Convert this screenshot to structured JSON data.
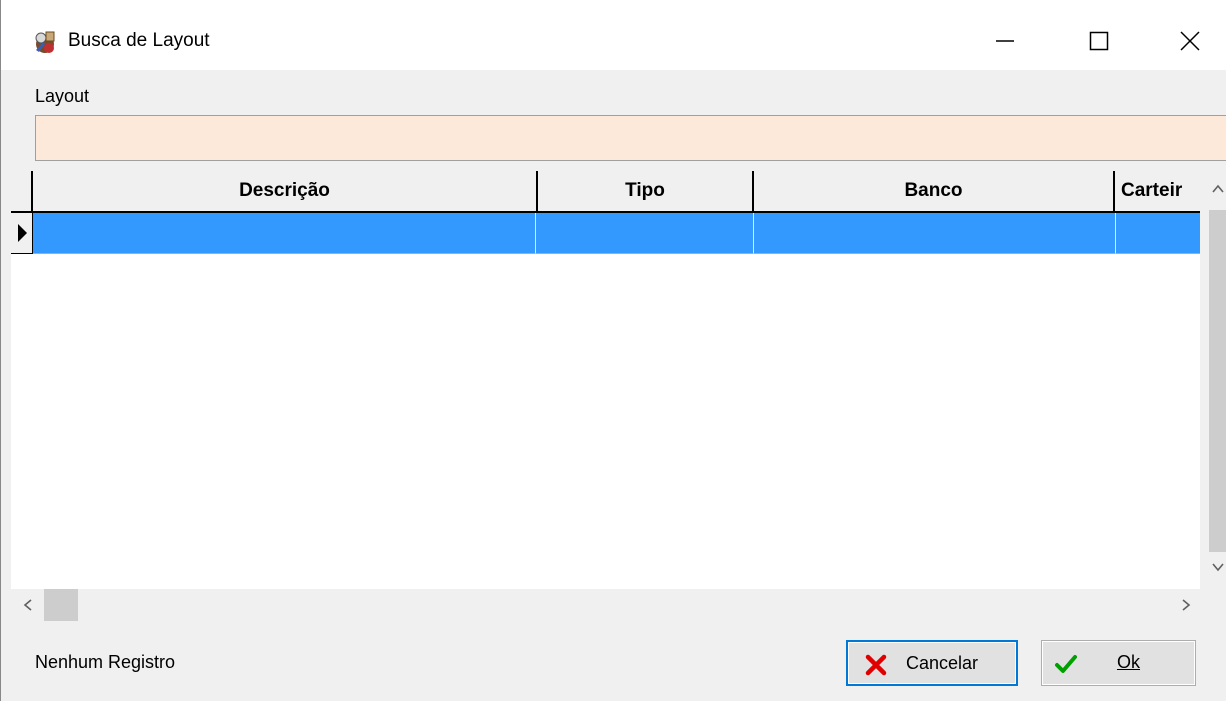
{
  "window": {
    "title": "Busca de Layout",
    "icon": "app-icon",
    "controls": [
      "minimize-icon",
      "maximize-icon",
      "close-icon"
    ]
  },
  "search": {
    "label": "Layout",
    "value": "",
    "placeholder": "",
    "field_color": "#fde9d9"
  },
  "grid": {
    "columns": [
      "Descrição",
      "Tipo",
      "Banco",
      "Carteir"
    ],
    "rows": [
      {
        "selected": true,
        "cells": [
          "",
          "",
          "",
          ""
        ]
      }
    ],
    "selection_color": "#3399ff",
    "row_indicator_icon": "current-row-arrow-icon"
  },
  "scrollbars": {
    "vertical": {
      "up_icon": "chevron-up-icon",
      "down_icon": "chevron-down-icon"
    },
    "horizontal": {
      "left_icon": "chevron-left-icon",
      "right_icon": "chevron-right-icon"
    }
  },
  "status": {
    "text": "Nenhum Registro"
  },
  "buttons": {
    "cancel": {
      "label": "Cancelar",
      "icon": "x-icon",
      "icon_color": "#e00000"
    },
    "ok": {
      "label": "Ok",
      "mnemonic": "O",
      "icon": "checkmark-icon",
      "icon_color": "#00a000"
    }
  }
}
